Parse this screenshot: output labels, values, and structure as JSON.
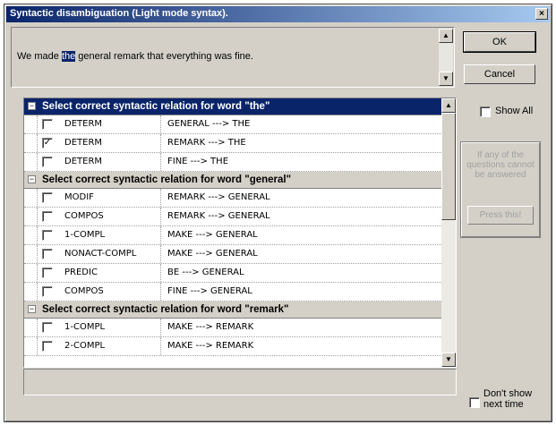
{
  "window": {
    "title": "Syntactic disambiguation (Light mode syntax).",
    "close_glyph": "×"
  },
  "sentence": {
    "before": "We made ",
    "highlight": "the",
    "after": " general remark that everything was fine."
  },
  "buttons": {
    "ok": "OK",
    "cancel": "Cancel",
    "press": "Press this!"
  },
  "show_all": {
    "label": "Show All",
    "checked": false
  },
  "info_text": "If any of the questions cannot be answered",
  "dont_show": {
    "label": "Don't show next time",
    "checked": false
  },
  "groups": [
    {
      "title": "Select correct syntactic relation for word \"the\"",
      "selected": true,
      "rows": [
        {
          "relation": "DETERM",
          "pair": "GENERAL ---> THE",
          "checked": false
        },
        {
          "relation": "DETERM",
          "pair": "REMARK ---> THE",
          "checked": true
        },
        {
          "relation": "DETERM",
          "pair": "FINE ---> THE",
          "checked": false
        }
      ]
    },
    {
      "title": "Select correct syntactic relation for word \"general\"",
      "selected": false,
      "rows": [
        {
          "relation": "MODIF",
          "pair": "REMARK ---> GENERAL",
          "checked": false
        },
        {
          "relation": "COMPOS",
          "pair": "REMARK ---> GENERAL",
          "checked": false
        },
        {
          "relation": "1-COMPL",
          "pair": "MAKE ---> GENERAL",
          "checked": false
        },
        {
          "relation": "NONACT-COMPL",
          "pair": "MAKE ---> GENERAL",
          "checked": false
        },
        {
          "relation": "PREDIC",
          "pair": "BE ---> GENERAL",
          "checked": false
        },
        {
          "relation": "COMPOS",
          "pair": "FINE ---> GENERAL",
          "checked": false
        }
      ]
    },
    {
      "title": "Select correct syntactic relation for word \"remark\"",
      "selected": false,
      "rows": [
        {
          "relation": "1-COMPL",
          "pair": "MAKE ---> REMARK",
          "checked": false
        },
        {
          "relation": "2-COMPL",
          "pair": "MAKE ---> REMARK",
          "checked": false
        }
      ]
    }
  ],
  "colors": {
    "selection": "#0a246a",
    "face": "#d4d0c8",
    "disabled_text": "#a0a0a0"
  }
}
